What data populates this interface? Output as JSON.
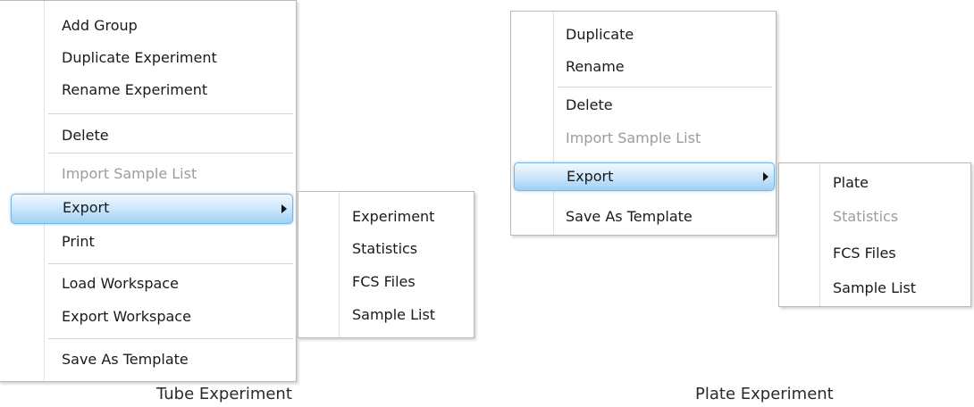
{
  "tube": {
    "items": [
      {
        "label": "Add Group"
      },
      {
        "label": "Duplicate Experiment"
      },
      {
        "label": "Rename Experiment"
      },
      {
        "label": "Delete"
      },
      {
        "label": "Import Sample List",
        "disabled": true
      },
      {
        "label": "Export",
        "highlighted": true,
        "has_submenu": true
      },
      {
        "label": "Print"
      },
      {
        "label": "Load Workspace"
      },
      {
        "label": "Export Workspace"
      },
      {
        "label": "Save As Template"
      }
    ],
    "submenu": [
      {
        "label": "Experiment"
      },
      {
        "label": "Statistics"
      },
      {
        "label": "FCS Files"
      },
      {
        "label": "Sample List"
      }
    ],
    "caption": "Tube Experiment"
  },
  "plate": {
    "items": [
      {
        "label": "Duplicate"
      },
      {
        "label": "Rename"
      },
      {
        "label": "Delete"
      },
      {
        "label": "Import Sample List",
        "disabled": true
      },
      {
        "label": "Export",
        "highlighted": true,
        "has_submenu": true
      },
      {
        "label": "Save As Template"
      }
    ],
    "submenu": [
      {
        "label": "Plate"
      },
      {
        "label": "Statistics",
        "disabled": true
      },
      {
        "label": "FCS Files"
      },
      {
        "label": "Sample List"
      }
    ],
    "caption": "Plate Experiment"
  },
  "colors": {
    "highlight_border": "#79b7e3",
    "highlight_fill": "#cfe8fb",
    "disabled_text": "#9c9c9c",
    "separator": "#d4d4d4"
  }
}
